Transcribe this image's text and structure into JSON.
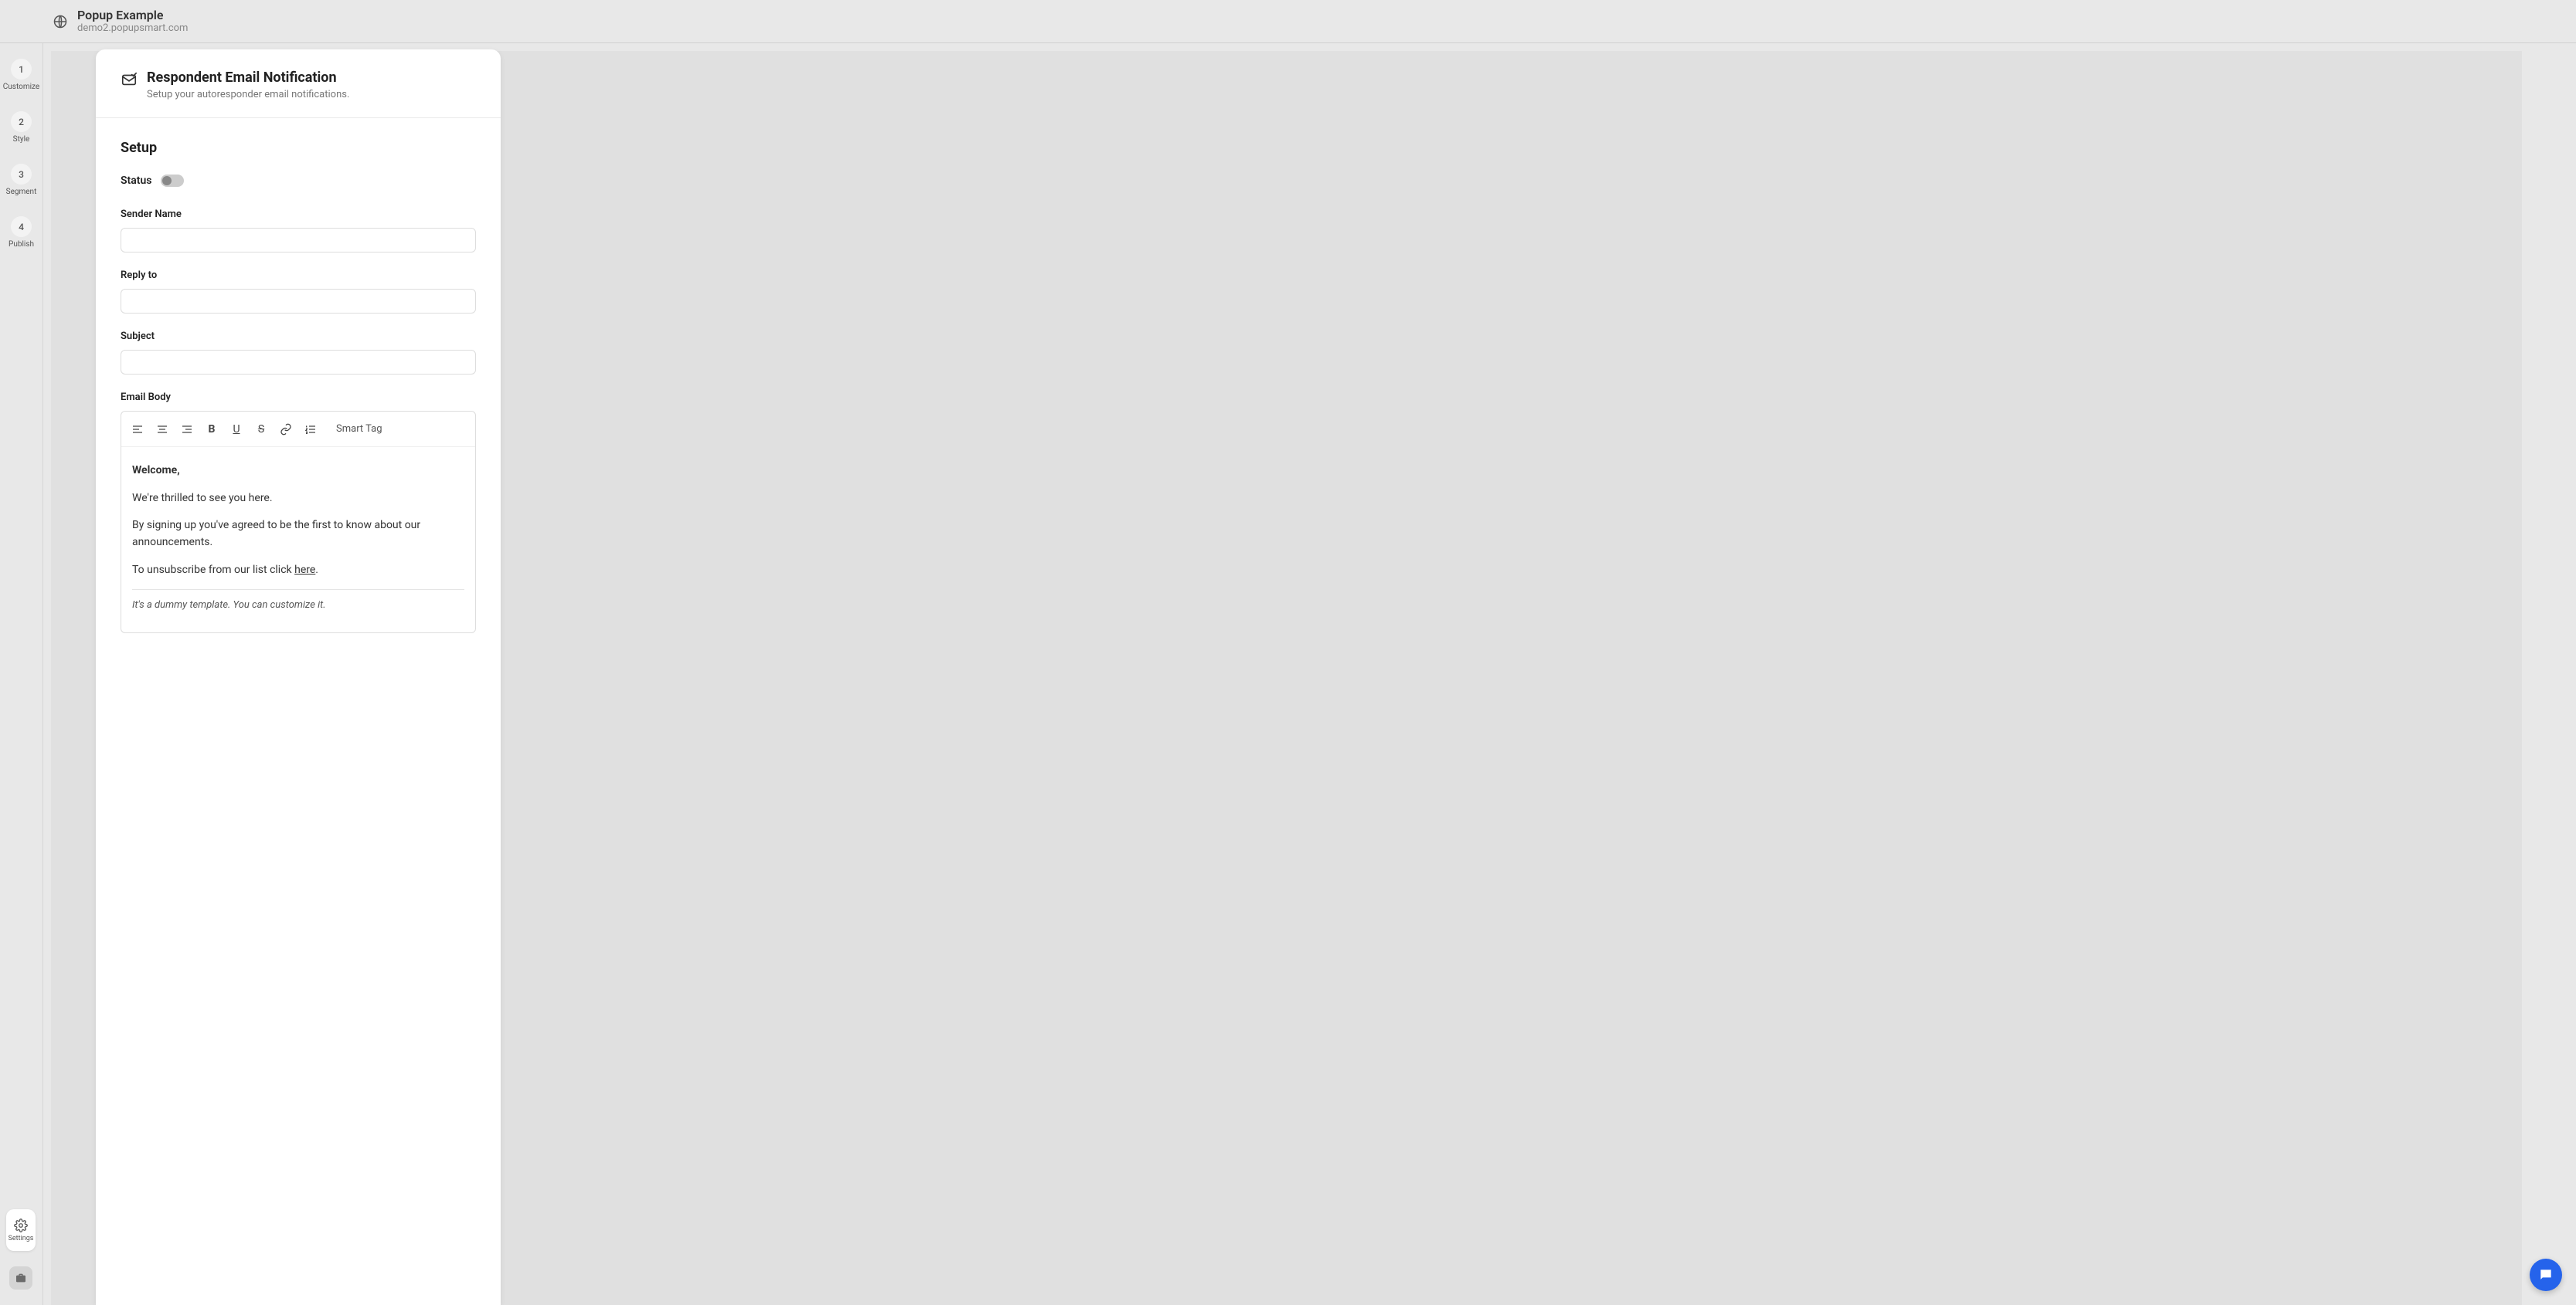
{
  "header": {
    "title": "Popup Example",
    "subtitle": "demo2.popupsmart.com"
  },
  "sidebar": {
    "steps": [
      {
        "num": "1",
        "label": "Customize"
      },
      {
        "num": "2",
        "label": "Style"
      },
      {
        "num": "3",
        "label": "Segment"
      },
      {
        "num": "4",
        "label": "Publish"
      }
    ],
    "settings_label": "Settings"
  },
  "panel": {
    "title": "Respondent Email Notification",
    "subtitle": "Setup your autoresponder email notifications.",
    "section_title": "Setup",
    "status_label": "Status",
    "status_on": false,
    "fields": {
      "sender_name": {
        "label": "Sender Name",
        "value": ""
      },
      "reply_to": {
        "label": "Reply to",
        "value": ""
      },
      "subject": {
        "label": "Subject",
        "value": ""
      },
      "email_body_label": "Email Body"
    },
    "toolbar": {
      "smart_tag": "Smart Tag"
    },
    "email_body": {
      "greeting": "Welcome,",
      "line1": "We're thrilled to see you here.",
      "line2": "By signing up you've agreed to be the first to know about our announcements.",
      "unsub_prefix": "To unsubscribe from our list click ",
      "unsub_link": "here",
      "unsub_suffix": ".",
      "footnote": "It's a dummy template. You can customize it."
    }
  }
}
